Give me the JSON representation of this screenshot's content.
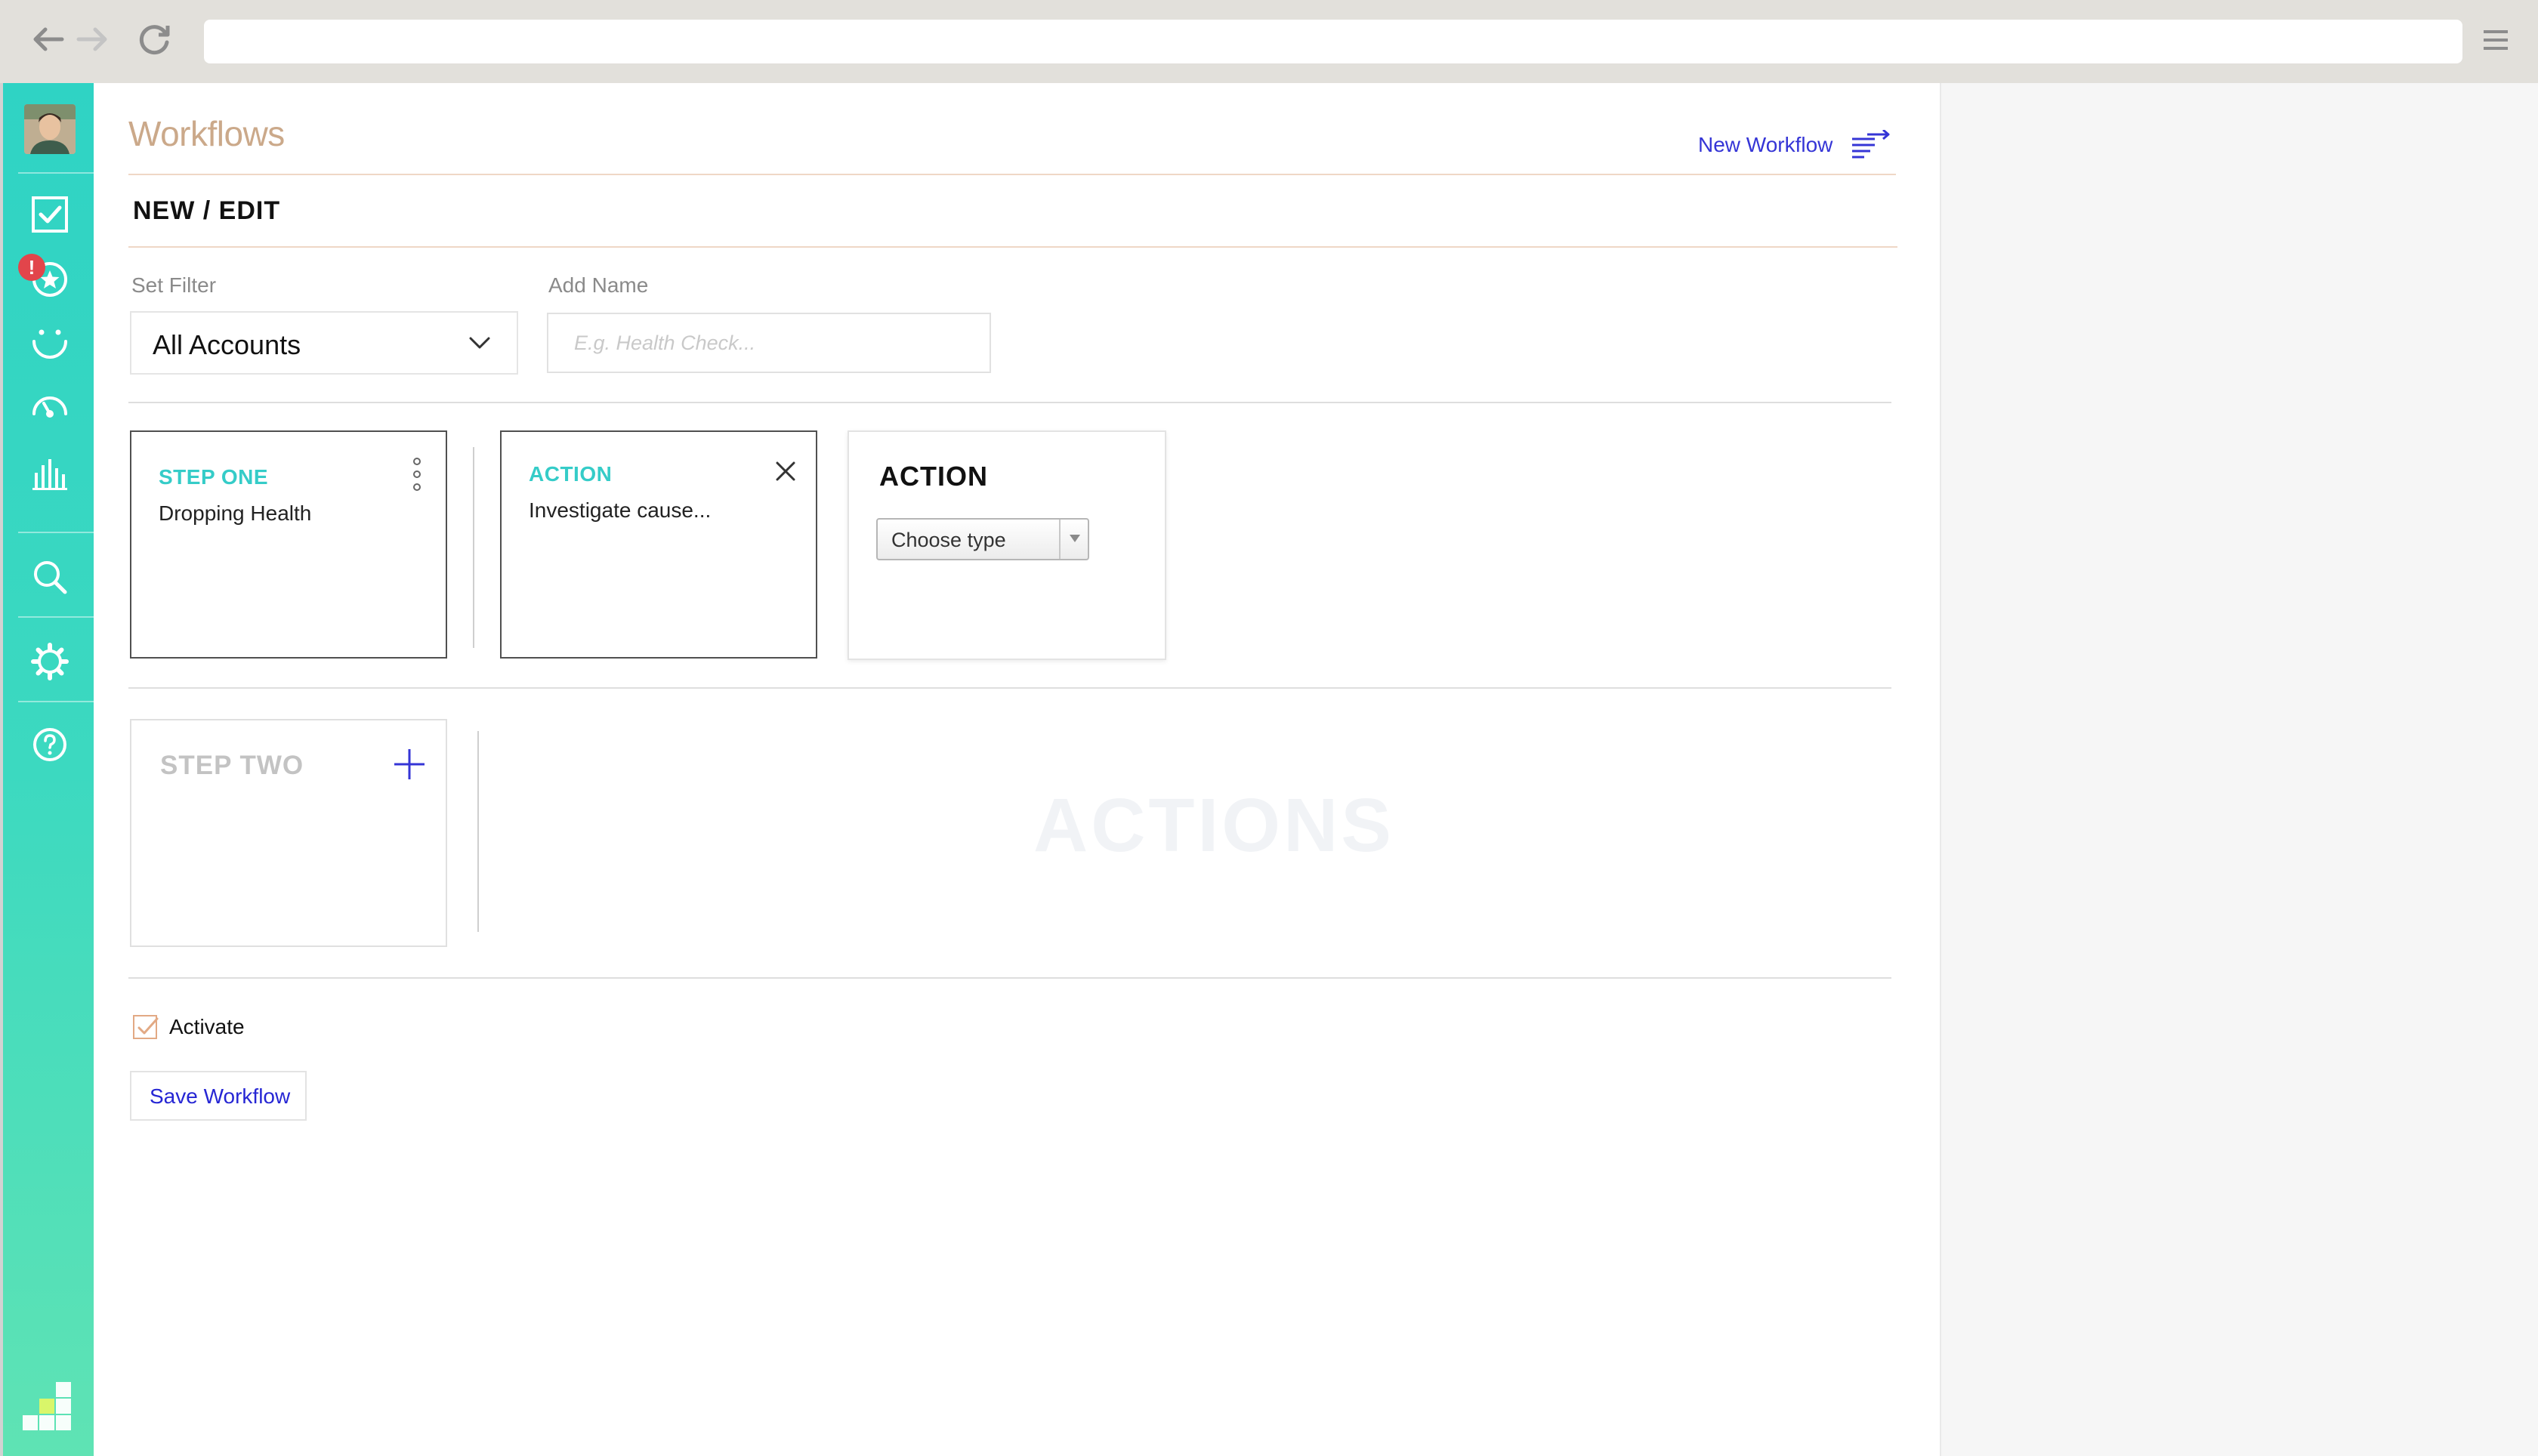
{
  "browser": {
    "url": ""
  },
  "colors": {
    "sidebar_gradient_top": "#2fd3c4",
    "sidebar_gradient_bottom": "#5fe3b4",
    "accent_teal": "#35ccc8",
    "link_blue": "#3535d6",
    "title_tan": "#cba98a"
  },
  "sidebar": {
    "items": [
      {
        "icon": "checkbox-icon"
      },
      {
        "icon": "star-icon",
        "badge": "!"
      },
      {
        "icon": "smile-icon"
      },
      {
        "icon": "gauge-icon"
      },
      {
        "icon": "bar-chart-icon"
      },
      {
        "icon": "search-icon"
      },
      {
        "icon": "gear-icon"
      },
      {
        "icon": "help-icon"
      }
    ]
  },
  "header": {
    "title": "Workflows",
    "new_workflow_label": "New Workflow"
  },
  "section": {
    "title": "NEW / EDIT"
  },
  "filter": {
    "label": "Set Filter",
    "value": "All Accounts"
  },
  "name_field": {
    "label": "Add Name",
    "value": "",
    "placeholder": "E.g. Health Check..."
  },
  "step_one": {
    "kicker": "STEP ONE",
    "text": "Dropping Health"
  },
  "action_existing": {
    "kicker": "ACTION",
    "text": "Investigate cause..."
  },
  "action_new": {
    "title": "ACTION",
    "type_select_value": "Choose type"
  },
  "step_two": {
    "kicker": "STEP TWO",
    "placeholder_watermark": "ACTIONS"
  },
  "footer": {
    "activate_label": "Activate",
    "activate_checked": true,
    "save_label": "Save Workflow"
  }
}
